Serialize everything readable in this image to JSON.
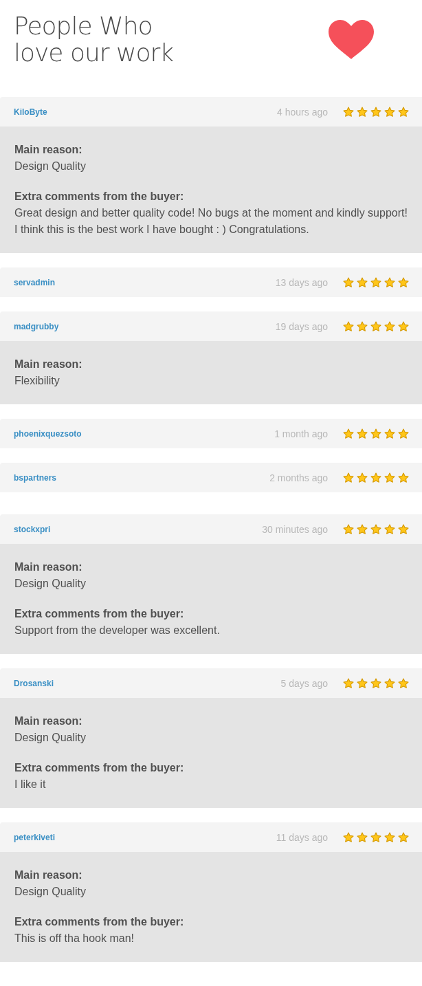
{
  "header": {
    "title_lines": [
      "People Who",
      "love our work"
    ]
  },
  "reviews": [
    {
      "user": "KiloByte",
      "time": "4 hours ago",
      "stars": 5,
      "reason_label": "Main reason:",
      "reason": "Design Quality",
      "comments_label": "Extra comments from the buyer:",
      "comments": "Great design and better quality code! No bugs at the moment and kindly support! I think this is the best work I have bought : ) Congratulations."
    },
    {
      "user": "servadmin",
      "time": "13 days ago",
      "stars": 5
    },
    {
      "user": "madgrubby",
      "time": "19 days ago",
      "stars": 5,
      "reason_label": "Main reason:",
      "reason": "Flexibility"
    },
    {
      "user": "phoenixquezsoto",
      "time": "1 month ago",
      "stars": 5
    },
    {
      "user": "bspartners",
      "time": "2 months ago",
      "stars": 5
    },
    {
      "user": "stockxpri",
      "time": "30 minutes ago",
      "stars": 5,
      "reason_label": "Main reason:",
      "reason": "Design Quality",
      "comments_label": "Extra comments from the buyer:",
      "comments": "Support from the developer was excellent."
    },
    {
      "user": "Drosanski",
      "time": "5 days ago",
      "stars": 5,
      "reason_label": "Main reason:",
      "reason": "Design Quality",
      "comments_label": "Extra comments from the buyer:",
      "comments": "I like it"
    },
    {
      "user": "peterkiveti",
      "time": "11 days ago",
      "stars": 5,
      "reason_label": "Main reason:",
      "reason": "Design Quality",
      "comments_label": "Extra comments from the buyer:",
      "comments": "This is off tha hook man!"
    }
  ]
}
